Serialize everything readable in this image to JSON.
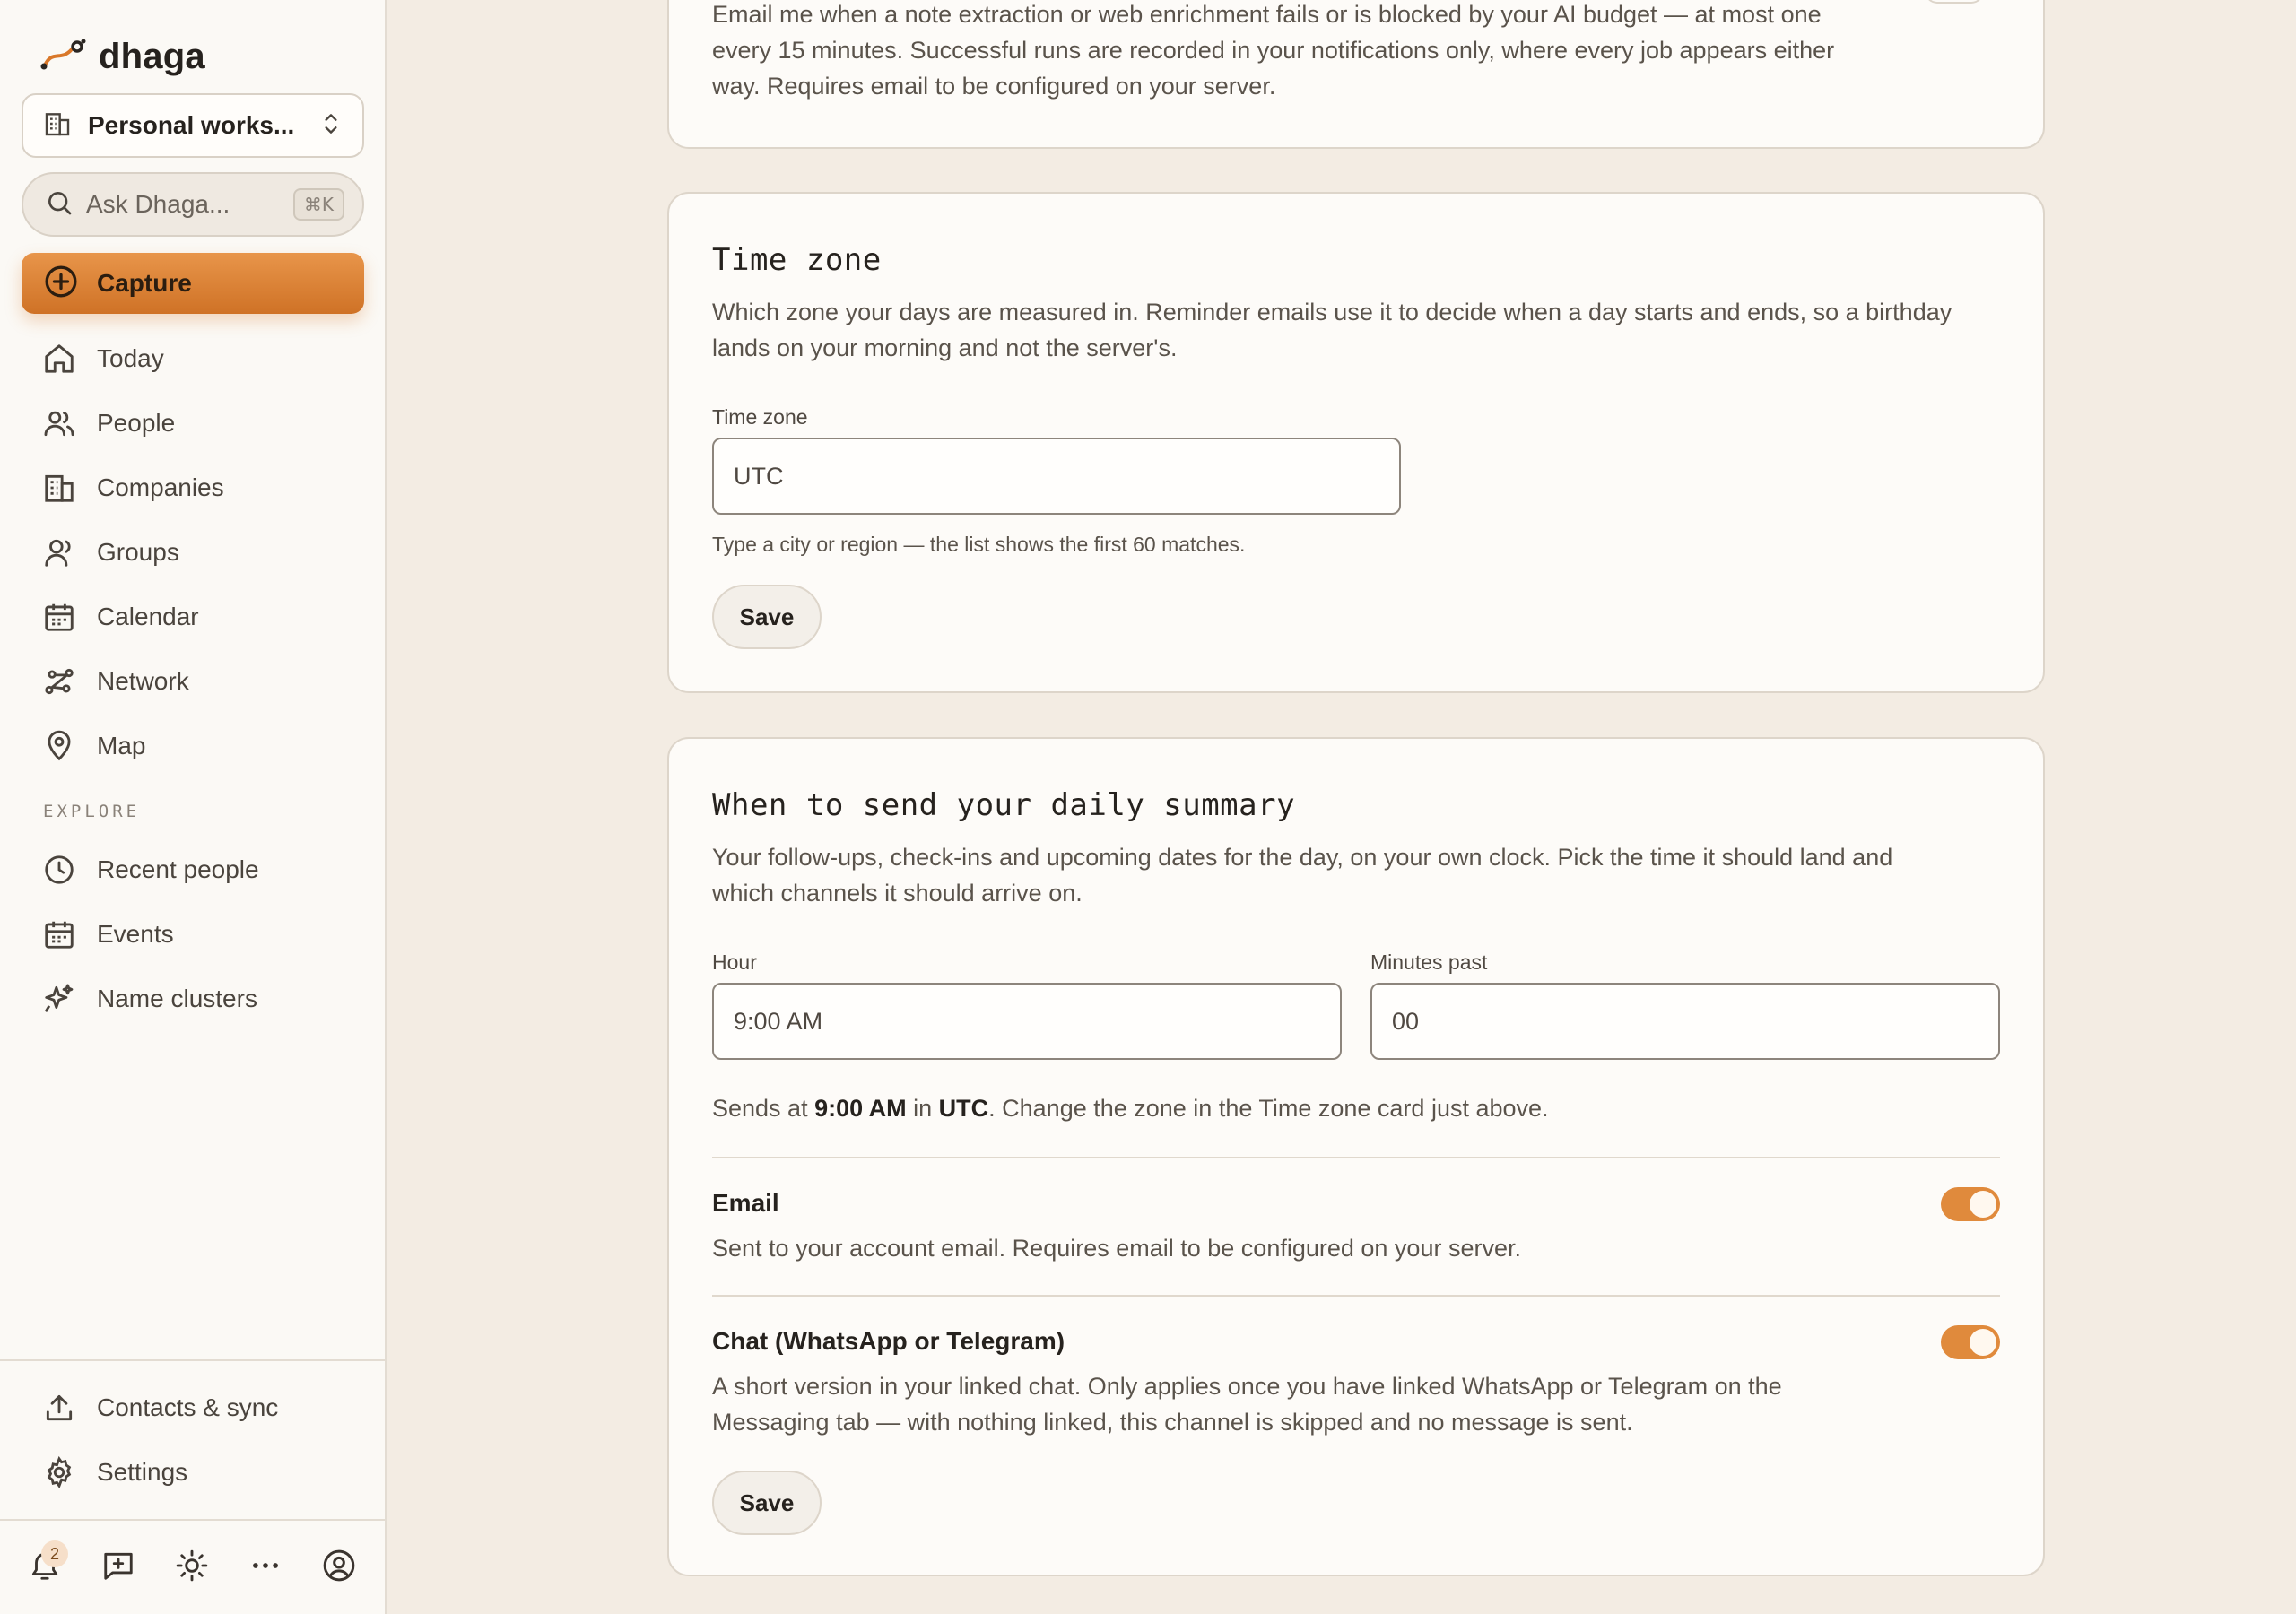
{
  "app": {
    "name": "dhaga"
  },
  "workspace": {
    "label": "Personal works..."
  },
  "search": {
    "placeholder": "Ask Dhaga...",
    "shortcut": "⌘K"
  },
  "capture": {
    "label": "Capture"
  },
  "nav": {
    "today": "Today",
    "people": "People",
    "companies": "Companies",
    "groups": "Groups",
    "calendar": "Calendar",
    "network": "Network",
    "map": "Map"
  },
  "explore": {
    "label": "EXPLORE",
    "recent_people": "Recent people",
    "events": "Events",
    "name_clusters": "Name clusters"
  },
  "footer_nav": {
    "contacts_sync": "Contacts & sync",
    "settings": "Settings"
  },
  "bottom_bar": {
    "notification_count": "2"
  },
  "failure_card": {
    "line1": "Email me when a note extraction or web enrichment fails or is blocked by your AI budget — at most one",
    "line2": "every 15 minutes. Successful runs are recorded in your notifications only, where every job appears either",
    "line3": "way. Requires email to be configured on your server."
  },
  "timezone_card": {
    "title": "Time zone",
    "desc1": "Which zone your days are measured in. Reminder emails use it to decide when a day starts and ends, so a birthday",
    "desc2": "lands on your morning and not the server's.",
    "field_label": "Time zone",
    "value": "UTC",
    "hint": "Type a city or region — the list shows the first 60 matches.",
    "save": "Save"
  },
  "summary_card": {
    "title": "When to send your daily summary",
    "desc1": "Your follow-ups, check-ins and upcoming dates for the day, on your own clock. Pick the time it should land and",
    "desc2": "which channels it should arrive on.",
    "hour_label": "Hour",
    "hour_value": "9:00 AM",
    "minutes_label": "Minutes past",
    "minutes_value": "00",
    "sends_prefix": "Sends at ",
    "sends_time": "9:00 AM",
    "sends_in": " in ",
    "sends_zone": "UTC",
    "sends_suffix": ". Change the zone in the Time zone card just above.",
    "email_title": "Email",
    "email_desc": "Sent to your account email. Requires email to be configured on your server.",
    "email_enabled": true,
    "chat_title": "Chat (WhatsApp or Telegram)",
    "chat_desc1": "A short version in your linked chat. Only applies once you have linked WhatsApp or Telegram on the",
    "chat_desc2": "Messaging tab — with nothing linked, this channel is skipped and no message is sent.",
    "chat_enabled": true,
    "save": "Save"
  },
  "colors": {
    "accent": "#e08a3c",
    "background": "#f3ece3",
    "card": "#fdfbf8"
  }
}
